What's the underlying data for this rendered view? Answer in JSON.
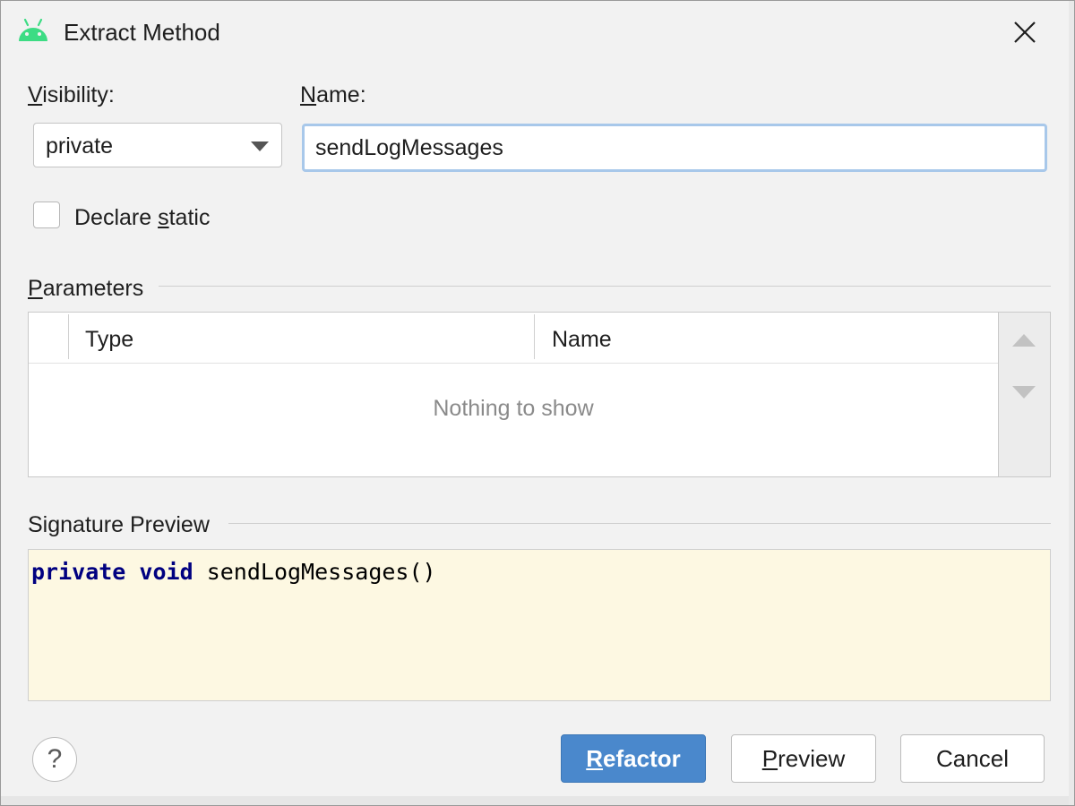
{
  "window": {
    "title": "Extract Method",
    "app_icon": "android-icon",
    "close_icon": "close-icon"
  },
  "visibility": {
    "label_mnemonic": "V",
    "label_rest": "isibility:",
    "selected": "private"
  },
  "name": {
    "label_mnemonic": "N",
    "label_rest": "ame:",
    "value": "sendLogMessages"
  },
  "declare_static": {
    "label_before": "Declare ",
    "label_mnemonic": "s",
    "label_after": "tatic",
    "checked": false
  },
  "parameters": {
    "section_mnemonic": "P",
    "section_rest": "arameters",
    "columns": [
      "Type",
      "Name"
    ],
    "empty_text": "Nothing to show",
    "toolbar": [
      "move-up-icon",
      "move-down-icon"
    ]
  },
  "signature_preview": {
    "section_title": "Signature Preview",
    "keyword_1": "private",
    "keyword_2": "void",
    "method_call": "sendLogMessages()"
  },
  "footer": {
    "help_glyph": "?",
    "refactor_mnemonic": "R",
    "refactor_rest": "efactor",
    "preview_mnemonic": "P",
    "preview_rest": "review",
    "cancel_label": "Cancel"
  },
  "colors": {
    "accent": "#4a88cc",
    "android_green": "#3ddc84",
    "keyword": "#000080",
    "preview_bg": "#fdf8e2",
    "focus_ring": "#a8c8ea"
  }
}
